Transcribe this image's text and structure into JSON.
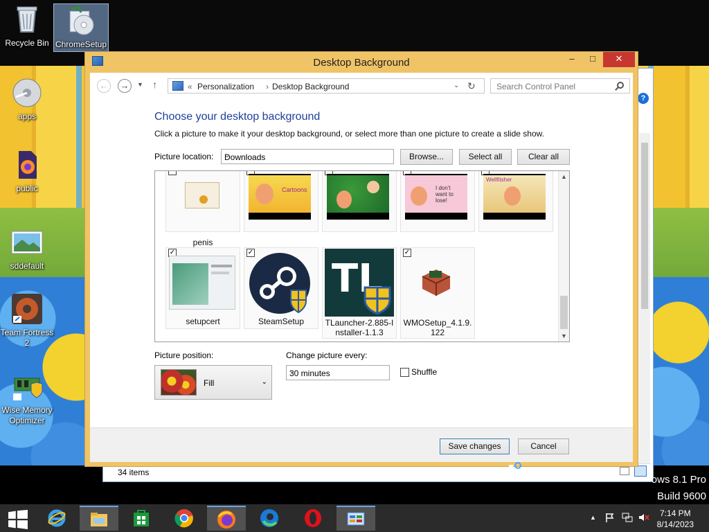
{
  "desktop": {
    "icons": [
      {
        "label": "Recycle Bin",
        "icon": "recycle-bin-icon"
      },
      {
        "label": "ChromeSetup",
        "icon": "installer-icon"
      },
      {
        "label": "apps",
        "icon": "disc-icon"
      },
      {
        "label": "public",
        "icon": "firefox-file-icon"
      },
      {
        "label": "sddefault",
        "icon": "image-file-icon"
      },
      {
        "label": "Team Fortress 2",
        "icon": "tf2-icon"
      },
      {
        "label": "Wise Memory Optimizer",
        "icon": "memory-optimizer-icon"
      }
    ],
    "watermark": {
      "line1": "ows 8.1 Pro",
      "line2": "Build 9600"
    }
  },
  "background_window": {
    "status": "34 items"
  },
  "dialog": {
    "title": "Desktop Background",
    "address": {
      "prefix": "«",
      "crumb1": "Personalization",
      "separator": "›",
      "crumb2": "Desktop Background"
    },
    "search_placeholder": "Search Control Panel",
    "heading": "Choose your desktop background",
    "subtext": "Click a picture to make it your desktop background, or select more than one picture to create a slide show.",
    "picture_location_label": "Picture location:",
    "picture_location_value": "Downloads",
    "browse_label": "Browse...",
    "select_all_label": "Select all",
    "clear_all_label": "Clear all",
    "tiles_row1": [
      {
        "name": "penis",
        "checked": false
      },
      {
        "name": "",
        "checked": false
      },
      {
        "name": "",
        "checked": false
      },
      {
        "name": "",
        "checked": false
      },
      {
        "name": "",
        "checked": false
      }
    ],
    "cartoon_texts": [
      "Cartoons",
      "I don't want to lose!",
      "Wellfitsher"
    ],
    "tiles_row2": [
      {
        "name": "setupcert",
        "checked": true
      },
      {
        "name": "SteamSetup",
        "checked": true
      },
      {
        "name": "TLauncher-2.885-Installer-1.1.3",
        "name_line1": "TLauncher-2.885-I",
        "name_line2": "nstaller-1.1.3",
        "checked": true
      },
      {
        "name": "WMOSetup_4.1.9.122",
        "name_line1": "WMOSetup_4.1.9.",
        "name_line2": "122",
        "checked": true
      }
    ],
    "tl_logo_text": "TL",
    "picture_position_label": "Picture position:",
    "picture_position_value": "Fill",
    "change_every_label": "Change picture every:",
    "change_every_value": "30 minutes",
    "shuffle_label": "Shuffle",
    "shuffle_checked": false,
    "save_label": "Save changes",
    "cancel_label": "Cancel"
  },
  "taskbar": {
    "apps": [
      "start-icon",
      "internet-explorer-icon",
      "file-explorer-icon",
      "store-icon",
      "chrome-icon",
      "firefox-icon",
      "edge-icon",
      "opera-icon",
      "control-panel-icon"
    ],
    "time": "7:14 PM",
    "date": "8/14/2023"
  }
}
